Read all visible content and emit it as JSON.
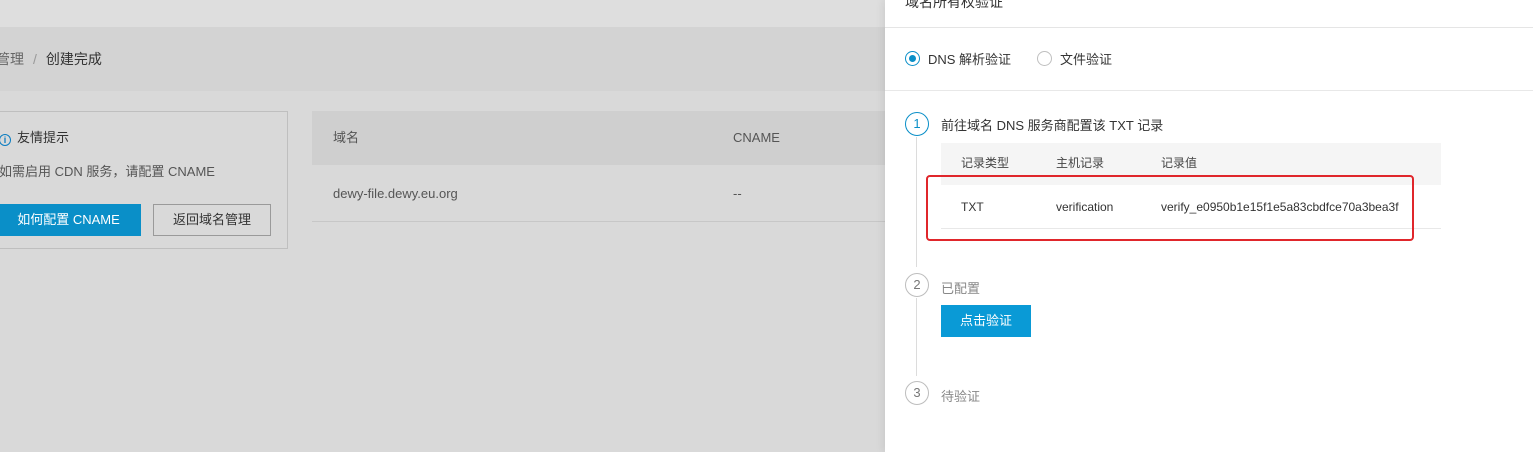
{
  "background": {
    "breadcrumb": {
      "prev": "管理",
      "separator": "/",
      "current": "创建完成"
    },
    "tip": {
      "info_icon": "i",
      "title": "友情提示",
      "text": "如需启用 CDN 服务，请配置 CNAME",
      "primary_button": "如何配置 CNAME",
      "secondary_button": "返回域名管理"
    },
    "table": {
      "headers": [
        "域名",
        "CNAME"
      ],
      "rows": [
        [
          "dewy-file.dewy.eu.org",
          "--"
        ]
      ]
    }
  },
  "drawer": {
    "title": "域名所有权验证",
    "radios": [
      {
        "label": "DNS 解析验证",
        "checked": true
      },
      {
        "label": "文件验证",
        "checked": false
      }
    ],
    "steps": [
      {
        "num": "1",
        "title": "前往域名 DNS 服务商配置该 TXT 记录"
      },
      {
        "num": "2",
        "title": "已配置"
      },
      {
        "num": "3",
        "title": "待验证"
      }
    ],
    "record_table": {
      "headers": [
        "记录类型",
        "主机记录",
        "记录值"
      ],
      "row": [
        "TXT",
        "verification",
        "verify_e0950b1e15f1e5a83cbdfce70a3bea3f"
      ]
    },
    "verify_button": "点击验证",
    "colors": {
      "accent": "#0a8fc8",
      "highlight": "#e0262b"
    }
  }
}
